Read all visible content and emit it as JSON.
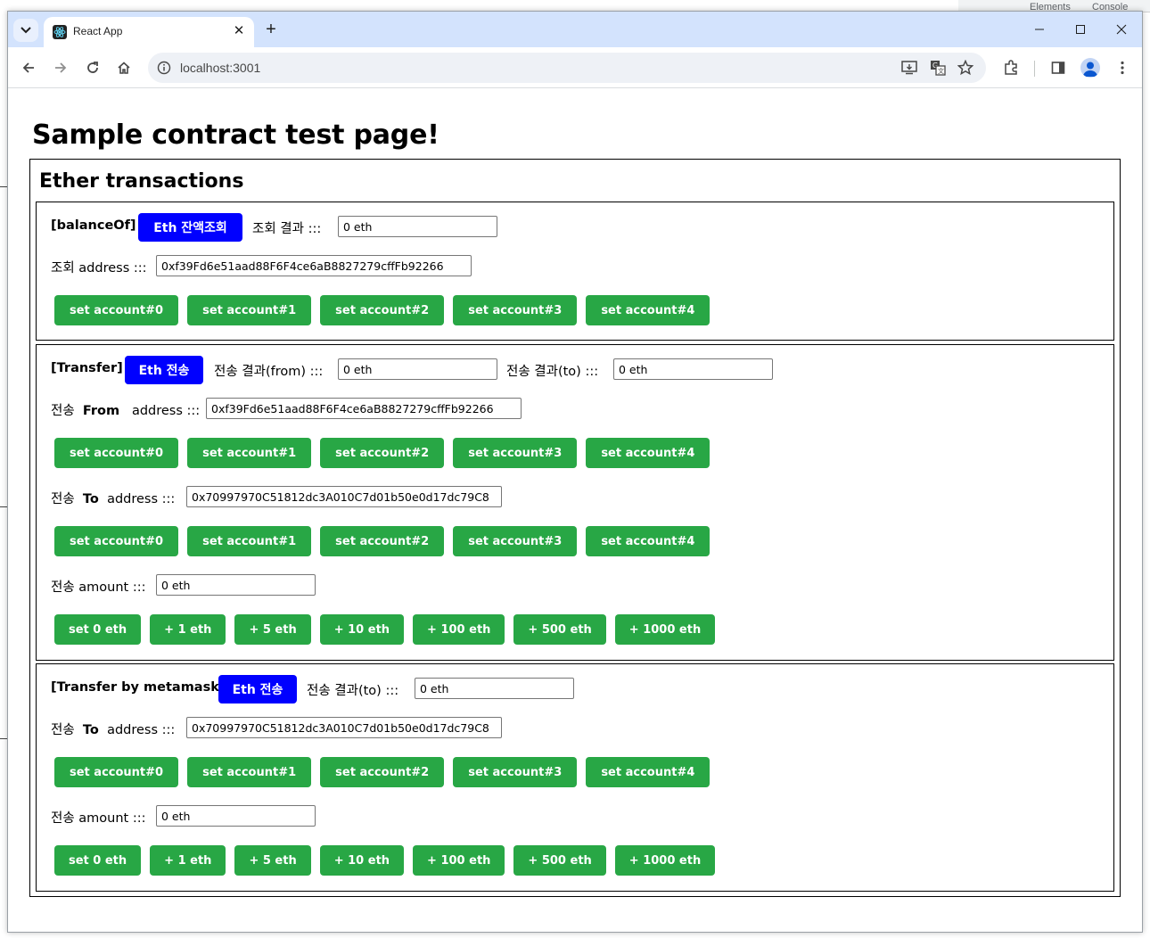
{
  "browser": {
    "tab_title": "React App",
    "url": "localhost:3001",
    "devtools_tabs": [
      "Elements",
      "Console"
    ]
  },
  "colors": {
    "titlebar": "#d3e3fd",
    "blue_button": "#0000ff",
    "green_button": "#28a745"
  },
  "page": {
    "title": "Sample contract test page!",
    "section_title": "Ether transactions",
    "account_buttons": [
      "set account#0",
      "set account#1",
      "set account#2",
      "set account#3",
      "set account#4"
    ],
    "amount_buttons": [
      "set 0 eth",
      "+ 1 eth",
      "+ 5 eth",
      "+ 10 eth",
      "+ 100 eth",
      "+ 500 eth",
      "+ 1000 eth"
    ],
    "balance": {
      "header": "[balanceOf]",
      "button": "Eth 잔액조회",
      "result_label": "조회 결과 :::",
      "result_value": "0 eth",
      "address_label": "조회 address :::",
      "address_value": "0xf39Fd6e51aad88F6F4ce6aB8827279cffFb92266"
    },
    "transfer": {
      "header": "[Transfer]",
      "button": "Eth 전송",
      "result_from_label": "전송 결과(from) :::",
      "result_from_value": "0 eth",
      "result_to_label": "전송 결과(to) :::",
      "result_to_value": "0 eth",
      "from_prefix": "전송",
      "from_bold": "From",
      "from_suffix": "address :::",
      "from_value": "0xf39Fd6e51aad88F6F4ce6aB8827279cffFb92266",
      "to_prefix": "전송",
      "to_bold": "To",
      "to_suffix": "address :::",
      "to_value": "0x70997970C51812dc3A010C7d01b50e0d17dc79C8",
      "amount_label": "전송 amount :::",
      "amount_value": "0 eth"
    },
    "metamask": {
      "header": "[Transfer by metamask]",
      "button": "Eth 전송",
      "result_to_label": "전송 결과(to) :::",
      "result_to_value": "0 eth",
      "to_prefix": "전송",
      "to_bold": "To",
      "to_suffix": "address :::",
      "to_value": "0x70997970C51812dc3A010C7d01b50e0d17dc79C8",
      "amount_label": "전송 amount :::",
      "amount_value": "0 eth"
    }
  }
}
